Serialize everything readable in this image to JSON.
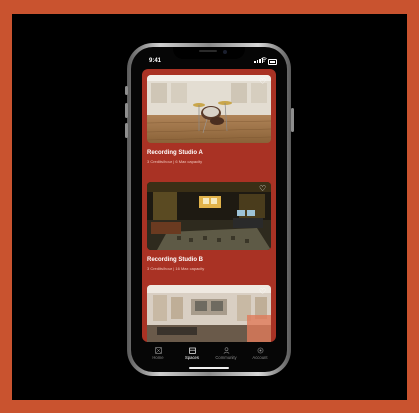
{
  "status": {
    "time": "9:41"
  },
  "spaces": [
    {
      "title": "Recording Studio A",
      "credits": "3 Credits/hour",
      "capacity": "6 Max capacity",
      "favorite": false
    },
    {
      "title": "Recording Studio B",
      "credits": "3 Credits/hour",
      "capacity": "16 Max capacity",
      "favorite": false
    },
    {
      "title": "",
      "credits": "",
      "capacity": "",
      "favorite": false
    }
  ],
  "tabs": [
    {
      "label": "Home",
      "icon": "home-icon",
      "active": false
    },
    {
      "label": "Spaces",
      "icon": "spaces-icon",
      "active": true
    },
    {
      "label": "Community",
      "icon": "community-icon",
      "active": false
    },
    {
      "label": "Account",
      "icon": "account-icon",
      "active": false
    }
  ],
  "colors": {
    "background": "#c9532f",
    "panel": "#a93224",
    "tab_active": "#ffffff",
    "tab_inactive": "#8a8a8a"
  }
}
